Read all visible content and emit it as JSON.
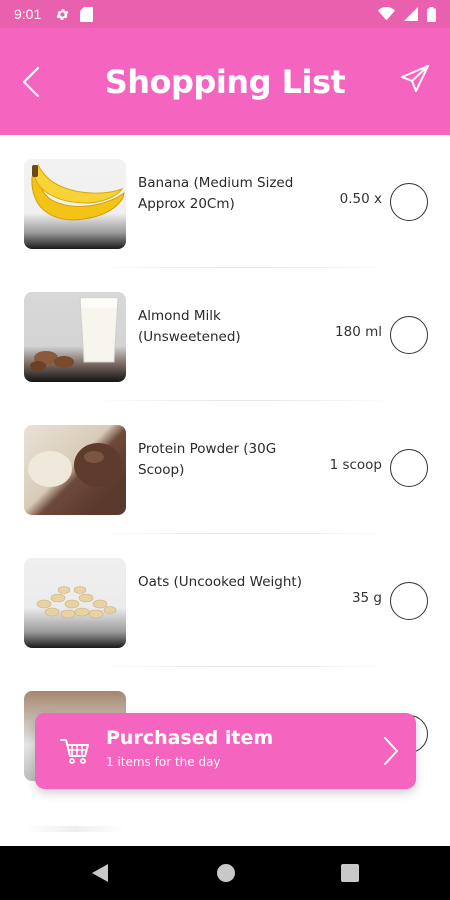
{
  "status_bar": {
    "time": "9:01",
    "icons": [
      "gear-icon",
      "sd-card-icon",
      "wifi-icon",
      "signal-icon",
      "battery-icon"
    ]
  },
  "header": {
    "title": "Shopping List",
    "left_icon": "back-arrow-icon",
    "right_icon": "send-icon"
  },
  "items": [
    {
      "name": "Banana (Medium Sized Approx 20Cm)",
      "quantity": "0.50 x",
      "image": "banana",
      "checked": false
    },
    {
      "name": "Almond Milk (Unsweetened)",
      "quantity": "180 ml",
      "image": "almond-milk",
      "checked": false
    },
    {
      "name": "Protein Powder (30G Scoop)",
      "quantity": "1 scoop",
      "image": "protein-powder",
      "checked": false
    },
    {
      "name": "Oats (Uncooked Weight)",
      "quantity": "35 g",
      "image": "oats",
      "checked": false
    },
    {
      "name": "",
      "quantity": "",
      "image": "seeds",
      "checked": false
    }
  ],
  "banner": {
    "title": "Purchased item",
    "subtitle": "1 items for the day",
    "icon": "cart-icon"
  },
  "navigation": {
    "icons": [
      "back-triangle-icon",
      "home-circle-icon",
      "recents-square-icon"
    ]
  },
  "colors": {
    "brand_pink": "#f564be",
    "status_bar": "#e860ae"
  }
}
